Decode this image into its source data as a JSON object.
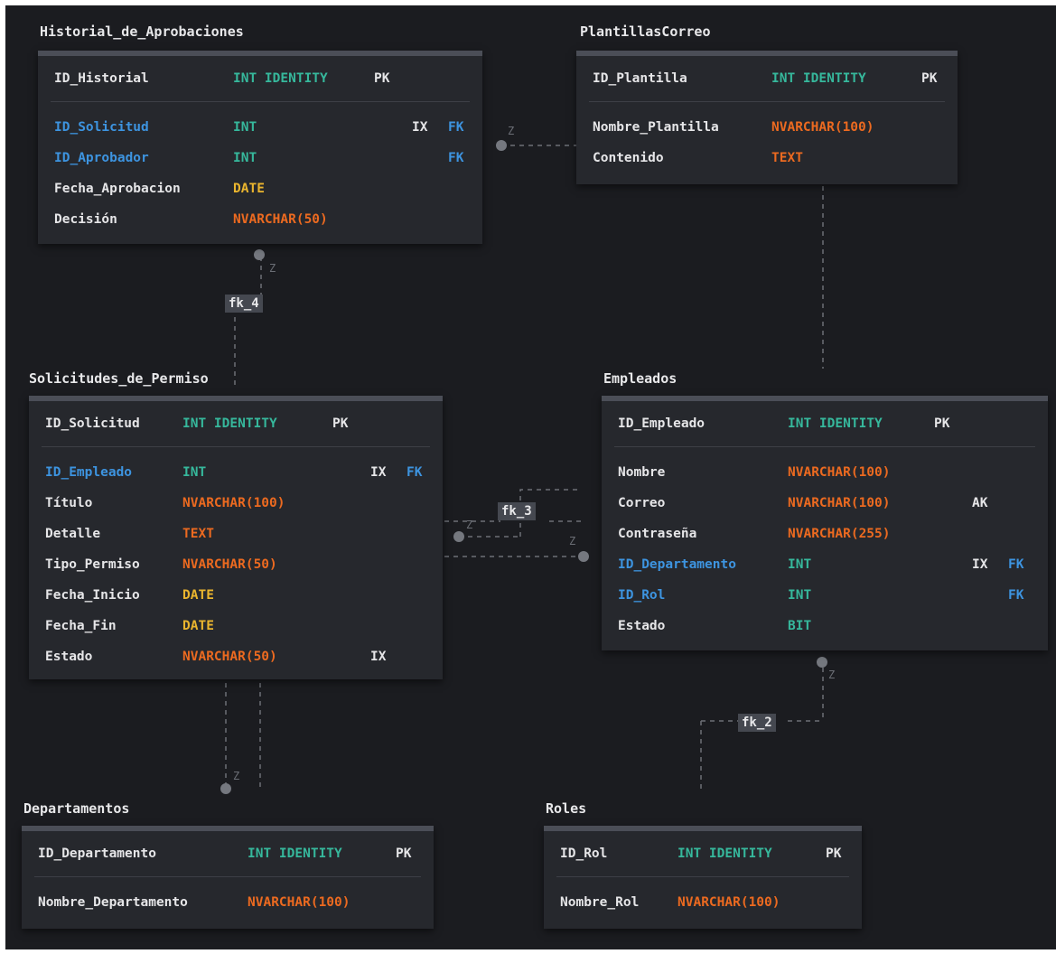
{
  "tables": {
    "historial": {
      "title": "Historial_de_Aprobaciones",
      "pk": {
        "name": "ID_Historial",
        "type": "INT IDENTITY",
        "tag": "PK"
      },
      "cols": [
        {
          "name": "ID_Solicitud",
          "type": "INT",
          "idx": "IX",
          "fk": "FK"
        },
        {
          "name": "ID_Aprobador",
          "type": "INT",
          "idx": "",
          "fk": "FK"
        },
        {
          "name": "Fecha_Aprobacion",
          "type": "DATE",
          "idx": "",
          "fk": ""
        },
        {
          "name": "Decisión",
          "type": "NVARCHAR(50)",
          "idx": "",
          "fk": ""
        }
      ]
    },
    "plantillas": {
      "title": "PlantillasCorreo",
      "pk": {
        "name": "ID_Plantilla",
        "type": "INT IDENTITY",
        "tag": "PK"
      },
      "cols": [
        {
          "name": "Nombre_Plantilla",
          "type": "NVARCHAR(100)"
        },
        {
          "name": "Contenido",
          "type": "TEXT"
        }
      ]
    },
    "solicitudes": {
      "title": "Solicitudes_de_Permiso",
      "pk": {
        "name": "ID_Solicitud",
        "type": "INT IDENTITY",
        "tag": "PK"
      },
      "cols": [
        {
          "name": "ID_Empleado",
          "type": "INT",
          "idx": "IX",
          "fk": "FK"
        },
        {
          "name": "Título",
          "type": "NVARCHAR(100)",
          "idx": "",
          "fk": ""
        },
        {
          "name": "Detalle",
          "type": "TEXT",
          "idx": "",
          "fk": ""
        },
        {
          "name": "Tipo_Permiso",
          "type": "NVARCHAR(50)",
          "idx": "",
          "fk": ""
        },
        {
          "name": "Fecha_Inicio",
          "type": "DATE",
          "idx": "",
          "fk": ""
        },
        {
          "name": "Fecha_Fin",
          "type": "DATE",
          "idx": "",
          "fk": ""
        },
        {
          "name": "Estado",
          "type": "NVARCHAR(50)",
          "idx": "IX",
          "fk": ""
        }
      ]
    },
    "empleados": {
      "title": "Empleados",
      "pk": {
        "name": "ID_Empleado",
        "type": "INT IDENTITY",
        "tag": "PK"
      },
      "cols": [
        {
          "name": "Nombre",
          "type": "NVARCHAR(100)",
          "idx": "",
          "fk": ""
        },
        {
          "name": "Correo",
          "type": "NVARCHAR(100)",
          "idx": "AK",
          "fk": ""
        },
        {
          "name": "Contraseña",
          "type": "NVARCHAR(255)",
          "idx": "",
          "fk": ""
        },
        {
          "name": "ID_Departamento",
          "type": "INT",
          "idx": "IX",
          "fk": "FK"
        },
        {
          "name": "ID_Rol",
          "type": "INT",
          "idx": "",
          "fk": "FK"
        },
        {
          "name": "Estado",
          "type": "BIT",
          "idx": "",
          "fk": ""
        }
      ]
    },
    "departamentos": {
      "title": "Departamentos",
      "pk": {
        "name": "ID_Departamento",
        "type": "INT IDENTITY",
        "tag": "PK"
      },
      "cols": [
        {
          "name": "Nombre_Departamento",
          "type": "NVARCHAR(100)"
        }
      ]
    },
    "roles": {
      "title": "Roles",
      "pk": {
        "name": "ID_Rol",
        "type": "INT IDENTITY",
        "tag": "PK"
      },
      "cols": [
        {
          "name": "Nombre_Rol",
          "type": "NVARCHAR(100)"
        }
      ]
    }
  },
  "relations": {
    "fk4": "fk_4",
    "fk3": "fk_3",
    "fk2": "fk_2",
    "z": "Z"
  },
  "colors": {
    "background": "#1b1c20",
    "table": "#26282d",
    "header_bar": "#4b4e57",
    "fk_column": "#3d94e0",
    "int_type": "#36b89c",
    "text_type": "#ec6a20",
    "date_type": "#eab52e"
  }
}
